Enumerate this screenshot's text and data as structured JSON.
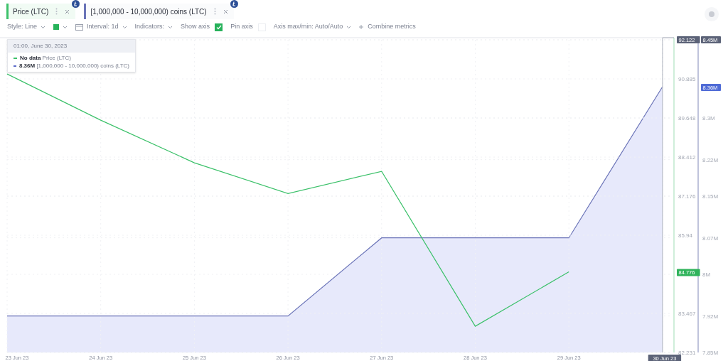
{
  "toolbar": [
    {
      "kind": "dropdown",
      "label": "Style: Line"
    },
    {
      "kind": "color",
      "color": "#27b35a"
    },
    {
      "kind": "interval",
      "label": "Interval: 1d"
    },
    {
      "kind": "dropdown",
      "label": "Indicators:"
    },
    {
      "kind": "checkbox",
      "label": "Show axis",
      "checked": true
    },
    {
      "kind": "checkbox",
      "label": "Pin axis",
      "checked": false
    },
    {
      "kind": "dropdown",
      "label": "Axis max/min: Auto/Auto"
    },
    {
      "kind": "add",
      "label": "Combine metrics"
    }
  ],
  "tooltip": {
    "date": "01:00, June 30, 2023",
    "rows": [
      {
        "value": "No data",
        "label": "Price (LTC)",
        "color": "#3cc16a"
      },
      {
        "value": "8.36M",
        "label": "[1,000,000 - 10,000,000) coins (LTC)",
        "color": "#5b6bc9"
      }
    ]
  },
  "charts": [
    {
      "chart_data": {
        "type": "line",
        "grid": true,
        "categories": [
          "23 Jun 23",
          "24 Jun 23",
          "25 Jun 23",
          "26 Jun 23",
          "27 Jun 23",
          "28 Jun 23",
          "29 Jun 23",
          "30 Jun 23"
        ],
        "series": [
          {
            "name": "Price (LTC)",
            "color": "#3cc16a",
            "values": [
              91.04,
              89.58,
              88.23,
              87.26,
              87.96,
              83.06,
              84.78,
              null
            ]
          }
        ],
        "ylim": [
          82.231,
          92.122
        ],
        "yticks": [
          82.231,
          83.467,
          85.94,
          87.176,
          88.412,
          89.648,
          90.885,
          92.122
        ]
      },
      "value_badge": {
        "label": "84.776",
        "color": "#2fb35b"
      }
    },
    {
      "chart_data": {
        "type": "area",
        "grid": true,
        "series": [
          {
            "name": "[1,000,000 - 10,000,000) coins (LTC)",
            "color": "#6b74b8",
            "values": [
              7.92,
              7.92,
              7.92,
              7.92,
              8.07,
              8.07,
              8.07,
              8.36
            ]
          }
        ],
        "ylim": [
          7.85,
          8.45
        ],
        "yticks": [
          {
            "value": 7.85,
            "label": "7.85M"
          },
          {
            "value": 7.92,
            "label": "7.92M"
          },
          {
            "value": 8,
            "label": "8M"
          },
          {
            "value": 8.07,
            "label": "8.07M"
          },
          {
            "value": 8.15,
            "label": "8.15M"
          },
          {
            "value": 8.22,
            "label": "8.22M"
          },
          {
            "value": 8.3,
            "label": "8.3M"
          },
          {
            "value": 8.45,
            "label": "8.45M"
          }
        ]
      },
      "value_badge": {
        "label": "8.36M",
        "color": "#4f6bd6"
      }
    }
  ]
}
